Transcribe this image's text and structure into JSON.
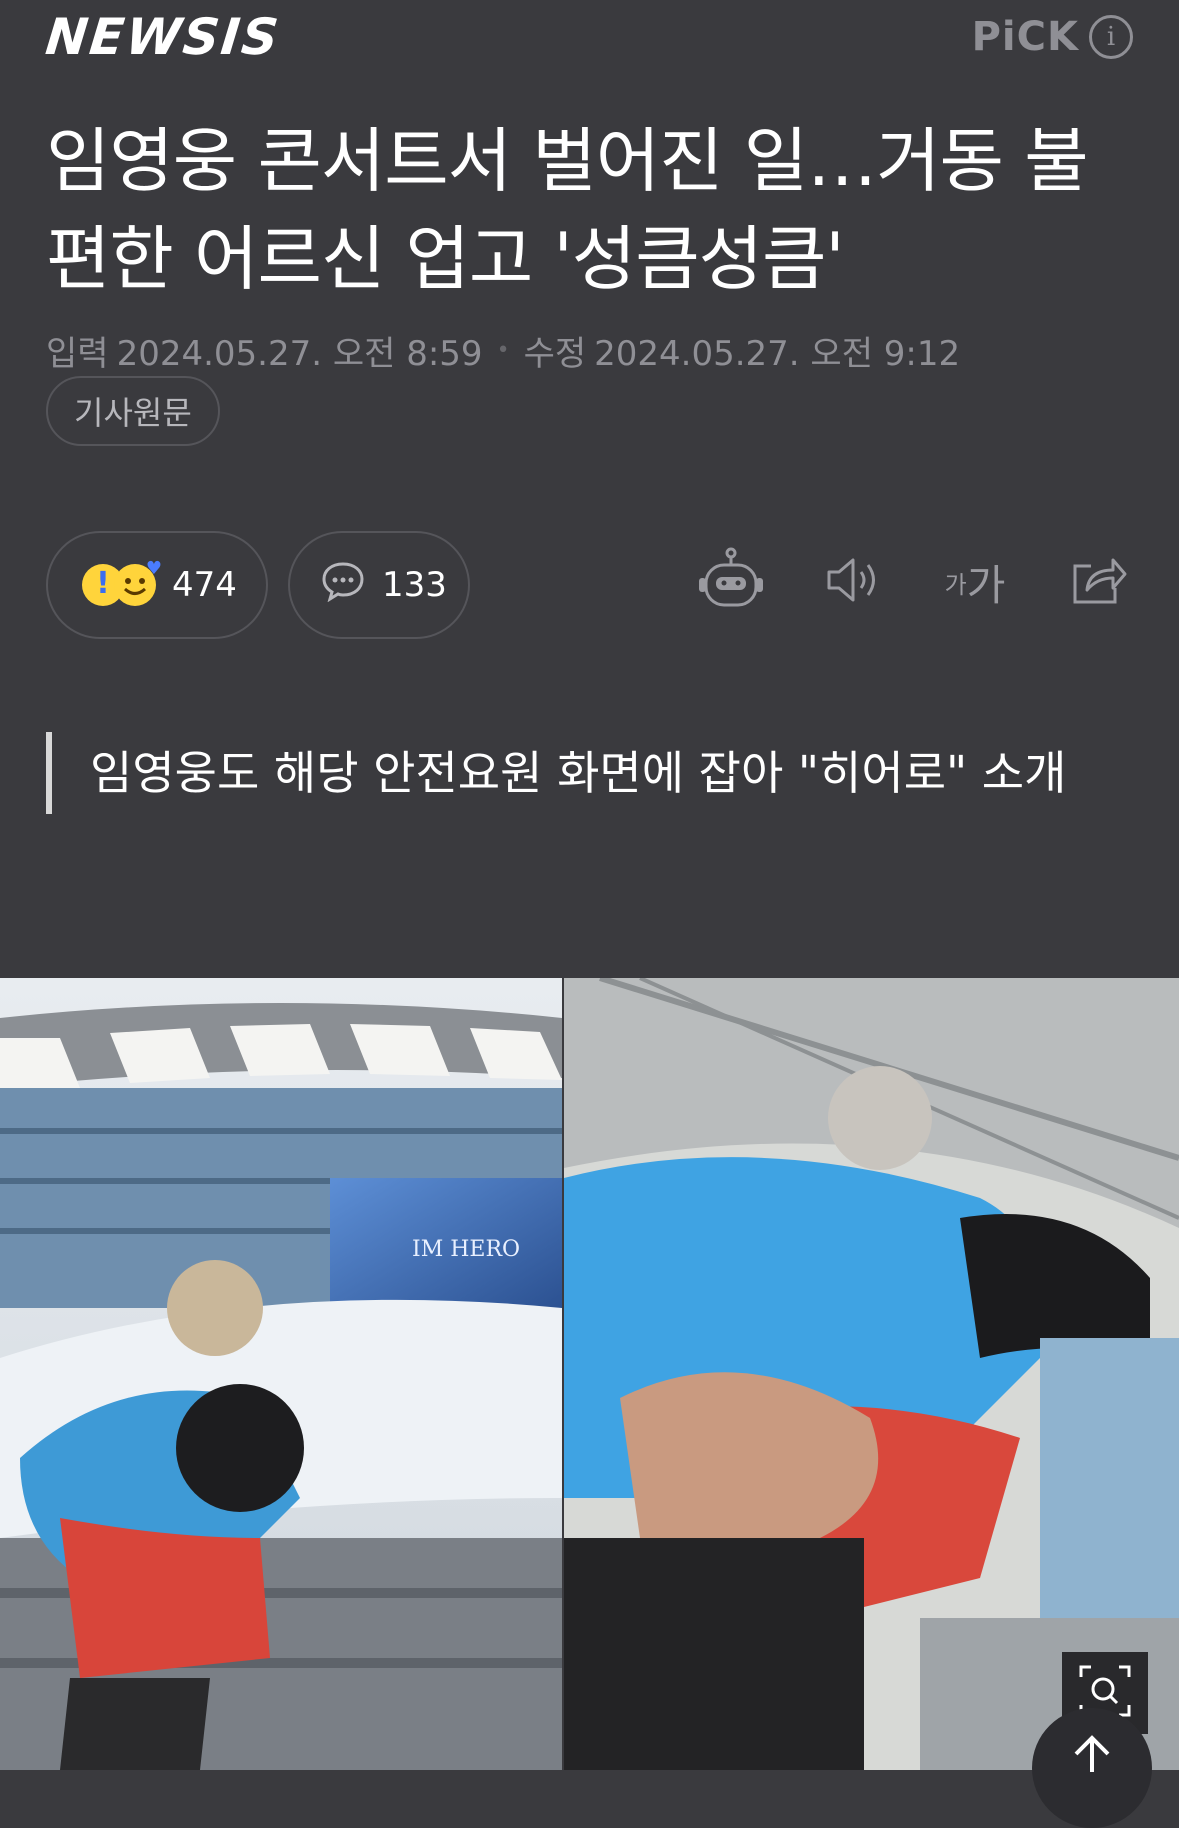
{
  "header": {
    "logo": "NEWSIS",
    "pick_label": "PiCK",
    "info_icon": "i"
  },
  "article": {
    "headline": "임영웅 콘서트서 벌어진 일…거동 불편한 어르신 업고 '성큼성큼'",
    "input_label": "입력",
    "input_time": "2024.05.27. 오전 8:59",
    "separator": "•",
    "modified_label": "수정",
    "modified_time": "2024.05.27. 오전 9:12",
    "original_button": "기사원문",
    "summary": "임영웅도 해당 안전요원 화면에 잡아 \"히어로\" 소개"
  },
  "actions": {
    "reaction_count": "474",
    "comment_count": "133",
    "font_small": "가",
    "font_large": "가"
  },
  "photo": {
    "screen_text": "IM HERO"
  },
  "colors": {
    "background": "#3a3a3e",
    "muted": "#8f8f95",
    "accent_blue": "#4a7cff",
    "emoji_yellow": "#ffd43b"
  }
}
